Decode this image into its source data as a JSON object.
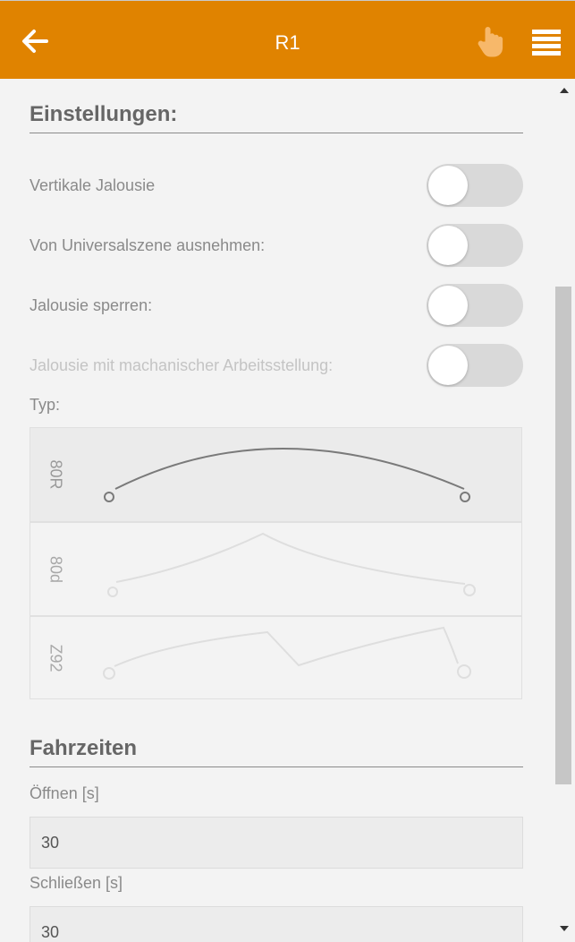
{
  "header": {
    "title": "R1",
    "back_icon": "arrow-left-icon",
    "hand_icon": "hand-pointer-icon",
    "menu_icon": "menu-icon",
    "accent_color": "#e08300"
  },
  "settings": {
    "title": "Einstellungen:",
    "items": [
      {
        "label": "Vertikale Jalousie",
        "on": false,
        "disabled": false
      },
      {
        "label": "Von Universalszene ausnehmen:",
        "on": false,
        "disabled": false
      },
      {
        "label": "Jalousie sperren:",
        "on": false,
        "disabled": false
      },
      {
        "label": "Jalousie mit machanischer Arbeitsstellung:",
        "on": false,
        "disabled": true
      }
    ],
    "typ_label": "Typ:",
    "types": [
      {
        "label": "80R",
        "selected": true
      },
      {
        "label": "80d",
        "selected": false
      },
      {
        "label": "Z92",
        "selected": false
      }
    ]
  },
  "fahrzeiten": {
    "title": "Fahrzeiten",
    "open_label": "Öffnen [s]",
    "open_value": "30",
    "close_label": "Schließen [s]",
    "close_value": "30"
  }
}
